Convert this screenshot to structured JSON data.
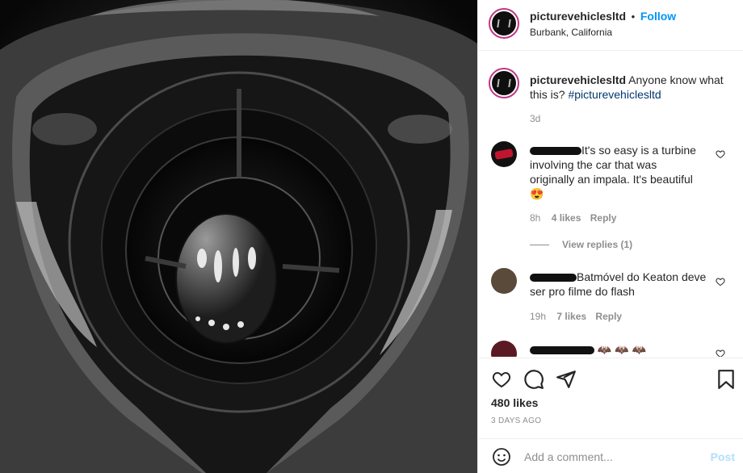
{
  "post": {
    "username": "picturevehiclesltd",
    "follow_label": "Follow",
    "location": "Burbank, California",
    "caption_username": "picturevehiclesltd",
    "caption_text": "Anyone know what",
    "caption_text2": "this is?",
    "caption_hashtag": "#picturevehiclesltd",
    "caption_time": "3d"
  },
  "comments": [
    {
      "text_line1": "It's so easy is a turbine",
      "text_line2": "involving the car that was",
      "text_line3": "originally an impala. It's beautiful",
      "emoji": "😍",
      "time": "8h",
      "likes": "4 likes",
      "reply": "Reply",
      "view_replies": "View replies (1)"
    },
    {
      "text_line1": "Batmóvel do Keaton deve",
      "text_line2": "ser pro filme do flash",
      "time": "19h",
      "likes": "7 likes",
      "reply": "Reply"
    },
    {
      "emoji": "🦇 🦇 🦇"
    }
  ],
  "actions": {
    "like_count": "480 likes",
    "posted_ago": "3 DAYS AGO"
  },
  "composer": {
    "placeholder": "Add a comment...",
    "post_label": "Post"
  },
  "colors": {
    "accent": "#0095f6",
    "story_ring": "#c13584",
    "muted": "#8e8e8e"
  }
}
